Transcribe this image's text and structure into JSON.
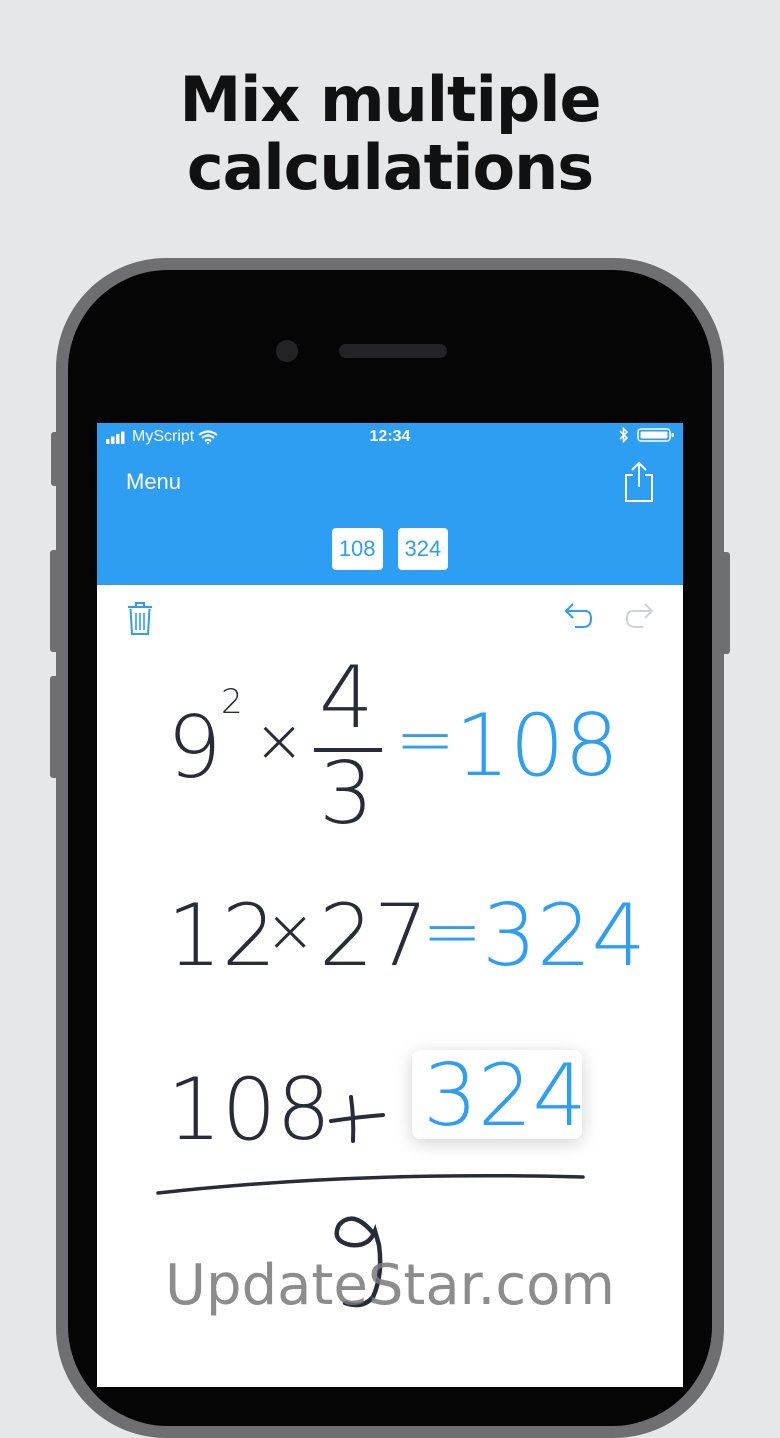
{
  "headline": {
    "line1": "Mix multiple",
    "line2": "calculations"
  },
  "status_bar": {
    "carrier": "MyScript",
    "time": "12:34"
  },
  "navbar": {
    "menu_label": "Menu"
  },
  "result_chips": [
    "108",
    "324"
  ],
  "expressions": {
    "row1": {
      "base": "9",
      "exponent": "2",
      "times": "×",
      "numerator": "4",
      "denominator": "3",
      "equals": "=",
      "result": "108"
    },
    "row2": {
      "a": "12",
      "times": "×",
      "b": "27",
      "equals": "=",
      "result": "324"
    },
    "row3": {
      "a": "108",
      "plus": "+",
      "b": "324",
      "written": "9"
    }
  },
  "watermark": "UpdateStar.com",
  "colors": {
    "accent": "#2e9ef3",
    "ink": "#272c38",
    "background": "#e6e7e9"
  }
}
